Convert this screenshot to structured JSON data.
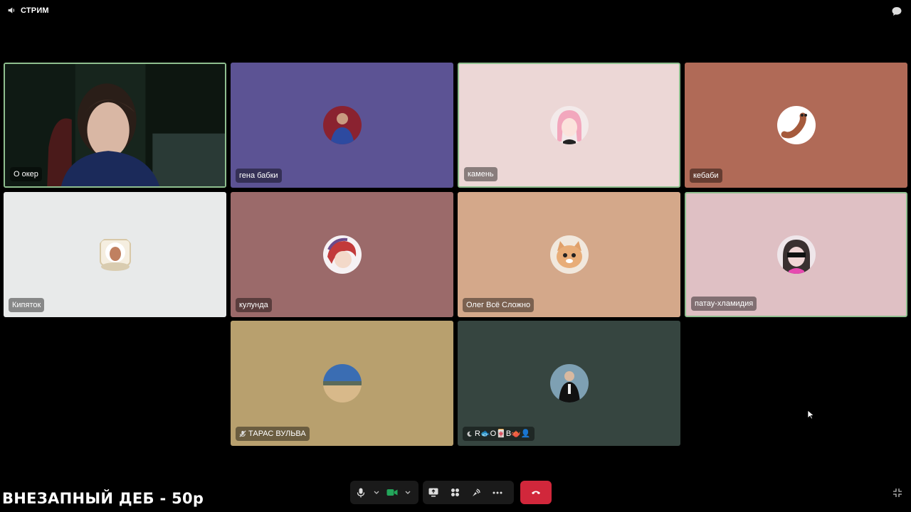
{
  "channel": {
    "name": "СТРИМ"
  },
  "participants": [
    {
      "name": "О окер",
      "bg": "#1c2a22",
      "speaking": true
    },
    {
      "name": "гена бабки",
      "bg": "#5c5394",
      "speaking": false
    },
    {
      "name": "камень",
      "bg": "#ecd7d6",
      "speaking": true
    },
    {
      "name": "кебаби",
      "bg": "#b06a57",
      "speaking": false
    },
    {
      "name": "Кипяток",
      "bg": "#e8eaea",
      "speaking": false
    },
    {
      "name": "кулунда",
      "bg": "#9b6a6a",
      "speaking": false
    },
    {
      "name": "Олег Всё Сложно",
      "bg": "#d4a88a",
      "speaking": false
    },
    {
      "name": "патау-хламидия",
      "bg": "#dfc0c4",
      "speaking": true
    },
    {
      "name": "ТАРАС ВУЛЬВА",
      "bg": "#b8a06e",
      "speaking": false,
      "muted": true
    },
    {
      "name": "R🐟O🀄B🫖👤",
      "bg": "#364540",
      "speaking": false
    }
  ],
  "controls": {
    "mic_icon": "microphone-icon",
    "camera_icon": "camera-icon",
    "screen_share_icon": "screen-share-icon",
    "activities_icon": "activities-icon",
    "soundboard_icon": "soundboard-icon",
    "more_icon": "more-icon",
    "hangup_icon": "phone-hangup-icon",
    "hangup_color": "#d1273b",
    "camera_color": "#23a55a"
  },
  "overlay": {
    "promo_text": "ВНЕЗАПНЫЙ ДЕБ - 50р"
  }
}
